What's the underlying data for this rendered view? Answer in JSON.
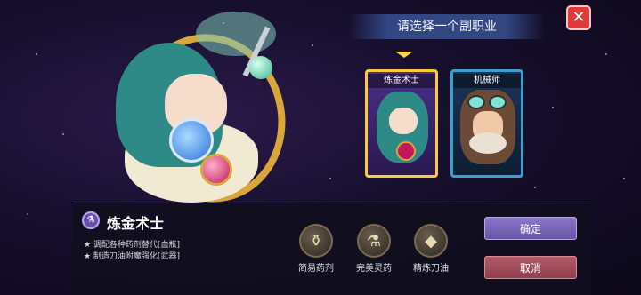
{
  "header": {
    "title": "请选择一个副职业",
    "close_label": "✕"
  },
  "cards": [
    {
      "label": "炼金术士",
      "selected": true
    },
    {
      "label": "机械师",
      "selected": false
    }
  ],
  "details": {
    "class_name": "炼金术士",
    "lines": [
      "★ 调配各种药剂替代[血瓶]",
      "★ 制造刀油附魔强化[武器]"
    ]
  },
  "items": [
    {
      "label": "简易药剂",
      "icon": "potion-icon"
    },
    {
      "label": "完美灵药",
      "icon": "elixir-icon"
    },
    {
      "label": "精炼刀油",
      "icon": "oil-icon"
    }
  ],
  "actions": {
    "confirm": "确定",
    "cancel": "取消"
  },
  "colors": {
    "accent": "#ffc93c",
    "close": "#e23a3a",
    "confirm": "#7a66b8",
    "cancel": "#a04c5c"
  }
}
